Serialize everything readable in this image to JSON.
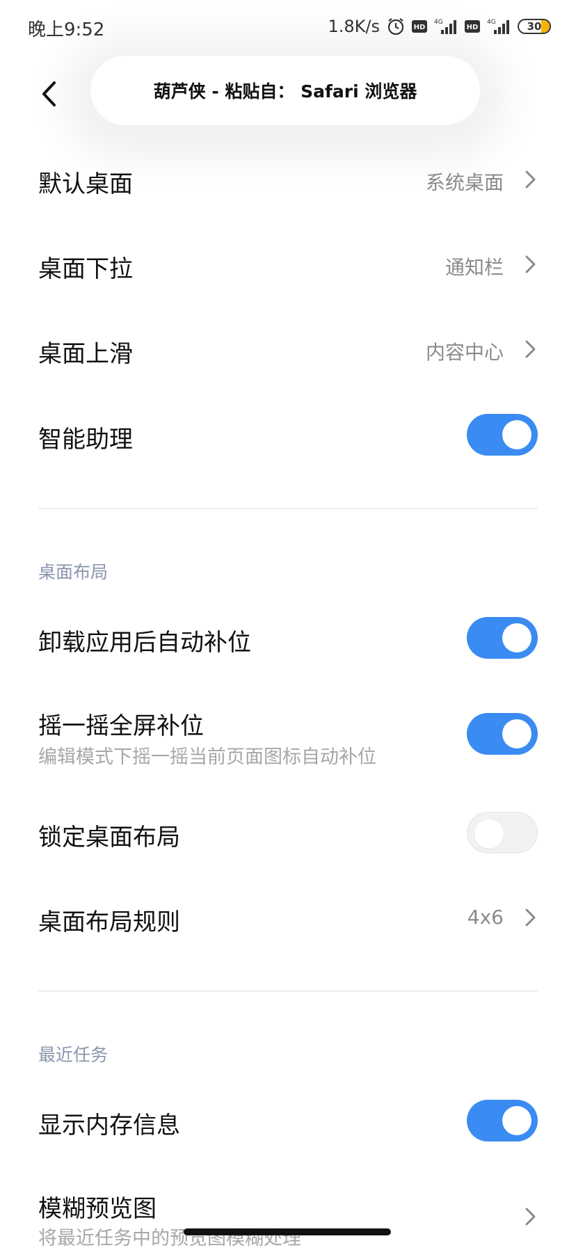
{
  "status_bar": {
    "time": "晚上9:52",
    "net_speed": "1.8K/s",
    "battery": "30"
  },
  "toast": {
    "text": "葫芦侠 - 粘贴自： Safari 浏览器"
  },
  "rows": [
    {
      "title": "默认桌面",
      "value": "系统桌面"
    },
    {
      "title": "桌面下拉",
      "value": "通知栏"
    },
    {
      "title": "桌面上滑",
      "value": "内容中心"
    },
    {
      "title": "智能助理",
      "toggle": true
    }
  ],
  "sections": [
    {
      "header": "桌面布局",
      "rows": [
        {
          "title": "卸载应用后自动补位",
          "toggle": true
        },
        {
          "title": "摇一摇全屏补位",
          "subtitle": "编辑模式下摇一摇当前页面图标自动补位",
          "toggle": true
        },
        {
          "title": "锁定桌面布局",
          "toggle": false
        },
        {
          "title": "桌面布局规则",
          "value": "4x6"
        }
      ]
    },
    {
      "header": "最近任务",
      "rows": [
        {
          "title": "显示内存信息",
          "toggle": true
        },
        {
          "title": "模糊预览图",
          "subtitle": "将最近任务中的预览图模糊处理"
        }
      ]
    }
  ],
  "colors": {
    "toggle_on": "#3a8bf2",
    "section_header": "#8a95ad"
  }
}
